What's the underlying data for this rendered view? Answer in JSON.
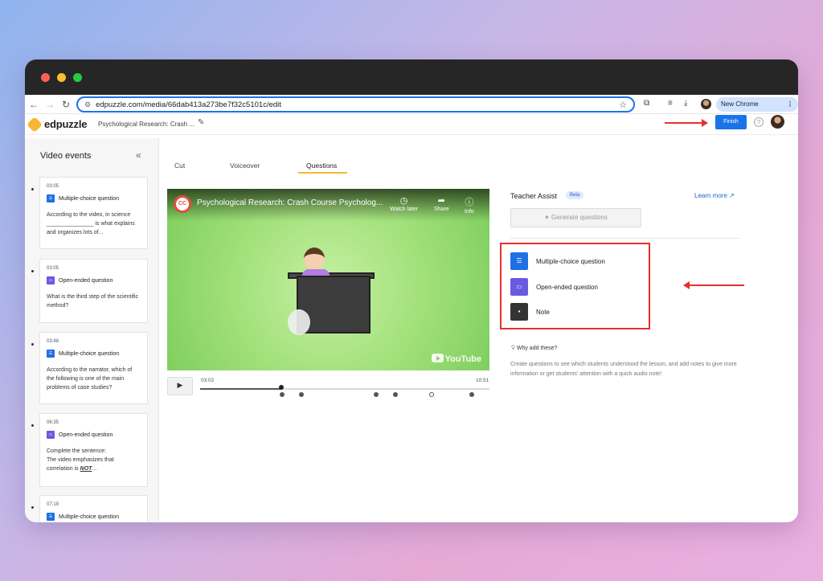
{
  "browser": {
    "url": "edpuzzle.com/media/66dab413a273be7f32c5101c/edit",
    "new_chrome": "New Chrome available"
  },
  "app": {
    "logo_text": "edpuzzle",
    "doc_title": "Psychological Research: Crash ...",
    "finish_label": "Finish",
    "help": "?"
  },
  "sidebar": {
    "title": "Video events",
    "events": [
      {
        "time": "03:05",
        "type": "Multiple-choice question",
        "text": "According to the video, in science _______________ is what explains and organizes lots of..."
      },
      {
        "time": "03:05",
        "type": "Open-ended question",
        "text": "What is the third step of the scientific method?"
      },
      {
        "time": "03:48",
        "type": "Multiple-choice question",
        "text": "According to the narrator, which of the following is one of the main problems of case studies?"
      },
      {
        "time": "06:35",
        "type": "Open-ended question",
        "text_a": "Complete the sentence:",
        "text_b": "The video emphasizes that",
        "text_c": "correlation is ",
        "text_em": "NOT",
        "text_d": "..."
      },
      {
        "time": "07:19",
        "type": "Multiple-choice question"
      }
    ]
  },
  "tabs": [
    "Cut",
    "Voiceover",
    "Questions"
  ],
  "video": {
    "title": "Psychological Research: Crash Course Psycholog...",
    "watch_later": "Watch later",
    "share": "Share",
    "info": "Info",
    "brand": "YouTube",
    "logo": "CC",
    "current_time": "03:02",
    "duration": "10:51",
    "progress": 0.28
  },
  "assist": {
    "title": "Teacher Assist",
    "beta": "Beta",
    "learn_more": "Learn more ↗",
    "generate": "Generate questions"
  },
  "add_items": [
    {
      "label": "Multiple-choice question",
      "icon": "list-icon"
    },
    {
      "label": "Open-ended question",
      "icon": "chat-icon"
    },
    {
      "label": "Note",
      "icon": "note-icon"
    }
  ],
  "why": {
    "title": "Why add these?",
    "text": "Create questions to see which students understood the lesson, and add notes to give more information or get students' attention with a quick audio note!"
  },
  "colors": {
    "accent": "#1a73e8",
    "mcq": "#1f6fe5",
    "open": "#6a5ae0",
    "annotation": "#e6302c"
  }
}
